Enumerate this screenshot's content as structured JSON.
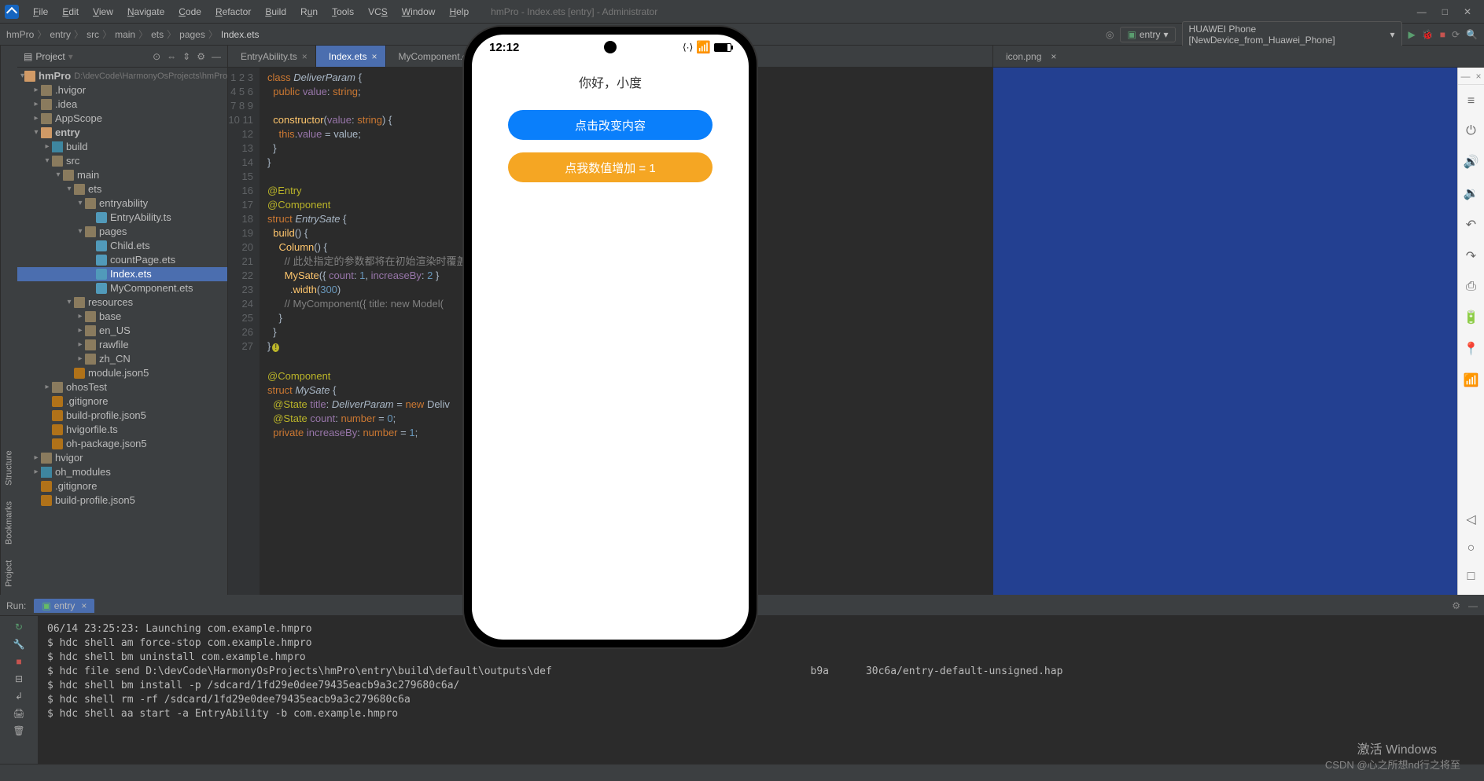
{
  "menu": {
    "file": "File",
    "edit": "Edit",
    "view": "View",
    "navigate": "Navigate",
    "code": "Code",
    "refactor": "Refactor",
    "build": "Build",
    "run": "Run",
    "tools": "Tools",
    "vcs": "VCS",
    "window": "Window",
    "help": "Help"
  },
  "window_title": "hmPro - Index.ets [entry] - Administrator",
  "breadcrumb": [
    "hmPro",
    "entry",
    "src",
    "main",
    "ets",
    "pages",
    "Index.ets"
  ],
  "right_tb": {
    "entry": "entry",
    "device": "HUAWEI Phone [NewDevice_from_Huawei_Phone]"
  },
  "side_labels": {
    "project": "Project",
    "bookmarks": "Bookmarks",
    "structure": "Structure"
  },
  "proj": {
    "title": "Project",
    "root": "hmPro",
    "root_path": "D:\\devCode\\HarmonyOsProjects\\hmPro",
    "items": [
      {
        "d": 1,
        "arrow": "▸",
        "icon": "fi-folder",
        "name": ".hvigor"
      },
      {
        "d": 1,
        "arrow": "▸",
        "icon": "fi-folder",
        "name": ".idea"
      },
      {
        "d": 1,
        "arrow": "▸",
        "icon": "fi-folder",
        "name": "AppScope"
      },
      {
        "d": 1,
        "arrow": "▾",
        "icon": "fi-folder-open",
        "name": "entry",
        "bold": true
      },
      {
        "d": 2,
        "arrow": "▸",
        "icon": "fi-folder-blue",
        "name": "build"
      },
      {
        "d": 2,
        "arrow": "▾",
        "icon": "fi-folder",
        "name": "src"
      },
      {
        "d": 3,
        "arrow": "▾",
        "icon": "fi-folder",
        "name": "main"
      },
      {
        "d": 4,
        "arrow": "▾",
        "icon": "fi-folder",
        "name": "ets"
      },
      {
        "d": 5,
        "arrow": "▾",
        "icon": "fi-folder",
        "name": "entryability"
      },
      {
        "d": 6,
        "arrow": " ",
        "icon": "fi-js",
        "name": "EntryAbility.ts"
      },
      {
        "d": 5,
        "arrow": "▾",
        "icon": "fi-folder",
        "name": "pages"
      },
      {
        "d": 6,
        "arrow": " ",
        "icon": "fi-js",
        "name": "Child.ets"
      },
      {
        "d": 6,
        "arrow": " ",
        "icon": "fi-js",
        "name": "countPage.ets"
      },
      {
        "d": 6,
        "arrow": " ",
        "icon": "fi-js",
        "name": "Index.ets",
        "sel": true
      },
      {
        "d": 6,
        "arrow": " ",
        "icon": "fi-js",
        "name": "MyComponent.ets"
      },
      {
        "d": 4,
        "arrow": "▾",
        "icon": "fi-folder",
        "name": "resources"
      },
      {
        "d": 5,
        "arrow": "▸",
        "icon": "fi-folder",
        "name": "base"
      },
      {
        "d": 5,
        "arrow": "▸",
        "icon": "fi-folder",
        "name": "en_US"
      },
      {
        "d": 5,
        "arrow": "▸",
        "icon": "fi-folder",
        "name": "rawfile"
      },
      {
        "d": 5,
        "arrow": "▸",
        "icon": "fi-folder",
        "name": "zh_CN"
      },
      {
        "d": 4,
        "arrow": " ",
        "icon": "fi-json",
        "name": "module.json5"
      },
      {
        "d": 2,
        "arrow": "▸",
        "icon": "fi-folder",
        "name": "ohosTest"
      },
      {
        "d": 2,
        "arrow": " ",
        "icon": "fi-json",
        "name": ".gitignore"
      },
      {
        "d": 2,
        "arrow": " ",
        "icon": "fi-json",
        "name": "build-profile.json5"
      },
      {
        "d": 2,
        "arrow": " ",
        "icon": "fi-json",
        "name": "hvigorfile.ts"
      },
      {
        "d": 2,
        "arrow": " ",
        "icon": "fi-json",
        "name": "oh-package.json5"
      },
      {
        "d": 1,
        "arrow": "▸",
        "icon": "fi-folder",
        "name": "hvigor"
      },
      {
        "d": 1,
        "arrow": "▸",
        "icon": "fi-folder-blue",
        "name": "oh_modules"
      },
      {
        "d": 1,
        "arrow": " ",
        "icon": "fi-json",
        "name": ".gitignore"
      },
      {
        "d": 1,
        "arrow": " ",
        "icon": "fi-json",
        "name": "build-profile.json5"
      }
    ]
  },
  "tabs": [
    {
      "name": "EntryAbility.ts",
      "active": false
    },
    {
      "name": "Index.ets",
      "active": true
    },
    {
      "name": "MyComponent.ets",
      "active": false
    }
  ],
  "right_tab": "icon.png",
  "code_lines": [
    1,
    2,
    3,
    4,
    5,
    6,
    7,
    8,
    9,
    10,
    11,
    12,
    13,
    14,
    15,
    16,
    17,
    18,
    19,
    20,
    21,
    22,
    23,
    24,
    25,
    26,
    27
  ],
  "phone": {
    "time": "12:12",
    "title": "你好，小度",
    "btn1": "点击改变内容",
    "btn2": "点我数值增加 = 1"
  },
  "run": {
    "label": "Run:",
    "tab": "entry",
    "lines": [
      "06/14 23:25:23: Launching com.example.hmpro",
      "$ hdc shell am force-stop com.example.hmpro",
      "$ hdc shell bm uninstall com.example.hmpro",
      "$ hdc file send D:\\devCode\\HarmonyOsProjects\\hmPro\\entry\\build\\default\\outputs\\def                                          b9a      30c6a/entry-default-unsigned.hap",
      "$ hdc shell bm install -p /sdcard/1fd29e0dee79435eacb9a3c279680c6a/",
      "$ hdc shell rm -rf /sdcard/1fd29e0dee79435eacb9a3c279680c6a",
      "$ hdc shell aa start -a EntryAbility -b com.example.hmpro"
    ]
  },
  "watermark1": "激活 Windows",
  "watermark2": "CSDN @心之所想nd行之将至"
}
